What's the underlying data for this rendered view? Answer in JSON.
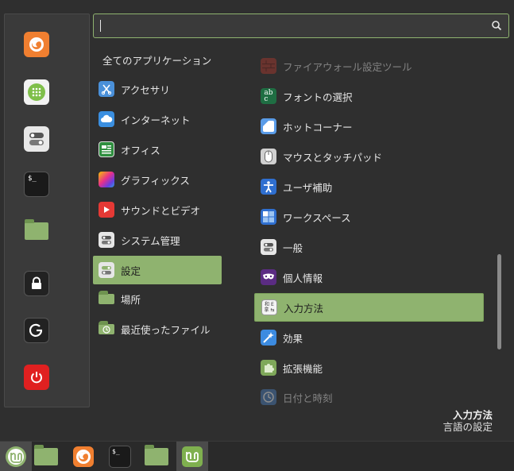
{
  "search": {
    "placeholder": "",
    "value": ""
  },
  "favorites": [
    {
      "name": "firefox-icon",
      "color": "#f0843c"
    },
    {
      "name": "apps-grid-icon",
      "color": "#7fbf4a"
    },
    {
      "name": "settings-toggle-icon",
      "color": "#d8d8d8"
    },
    {
      "name": "terminal-icon",
      "color": "#1a1a1a"
    },
    {
      "name": "folder-icon",
      "color": "#8fb36f"
    },
    {
      "name": "lock-icon",
      "color": "#222222"
    },
    {
      "name": "logout-icon",
      "color": "#222222"
    },
    {
      "name": "power-icon",
      "color": "#e02020"
    }
  ],
  "categories": {
    "header": "全てのアプリケーション",
    "items": [
      {
        "label": "アクセサリ",
        "icon": "accessories-icon"
      },
      {
        "label": "インターネット",
        "icon": "internet-icon"
      },
      {
        "label": "オフィス",
        "icon": "office-icon"
      },
      {
        "label": "グラフィックス",
        "icon": "graphics-icon"
      },
      {
        "label": "サウンドとビデオ",
        "icon": "sound-video-icon"
      },
      {
        "label": "システム管理",
        "icon": "system-admin-icon"
      },
      {
        "label": "設定",
        "icon": "settings-icon",
        "selected": true
      },
      {
        "label": "場所",
        "icon": "places-icon"
      },
      {
        "label": "最近使ったファイル",
        "icon": "recent-files-icon"
      }
    ]
  },
  "apps": [
    {
      "label": "ファイアウォール設定ツール",
      "icon": "firewall-icon",
      "dim": true
    },
    {
      "label": "フォントの選択",
      "icon": "font-icon"
    },
    {
      "label": "ホットコーナー",
      "icon": "hot-corner-icon"
    },
    {
      "label": "マウスとタッチパッド",
      "icon": "mouse-icon"
    },
    {
      "label": "ユーザ補助",
      "icon": "accessibility-icon"
    },
    {
      "label": "ワークスペース",
      "icon": "workspace-icon"
    },
    {
      "label": "一般",
      "icon": "general-icon"
    },
    {
      "label": "個人情報",
      "icon": "privacy-icon"
    },
    {
      "label": "入力方法",
      "icon": "input-method-icon",
      "selected": true
    },
    {
      "label": "効果",
      "icon": "effects-icon"
    },
    {
      "label": "拡張機能",
      "icon": "extensions-icon"
    },
    {
      "label": "日付と時刻",
      "icon": "date-time-icon",
      "dim": true
    }
  ],
  "description": {
    "title": "入力方法",
    "subtitle": "言語の設定"
  },
  "accent": "#8fb36f"
}
